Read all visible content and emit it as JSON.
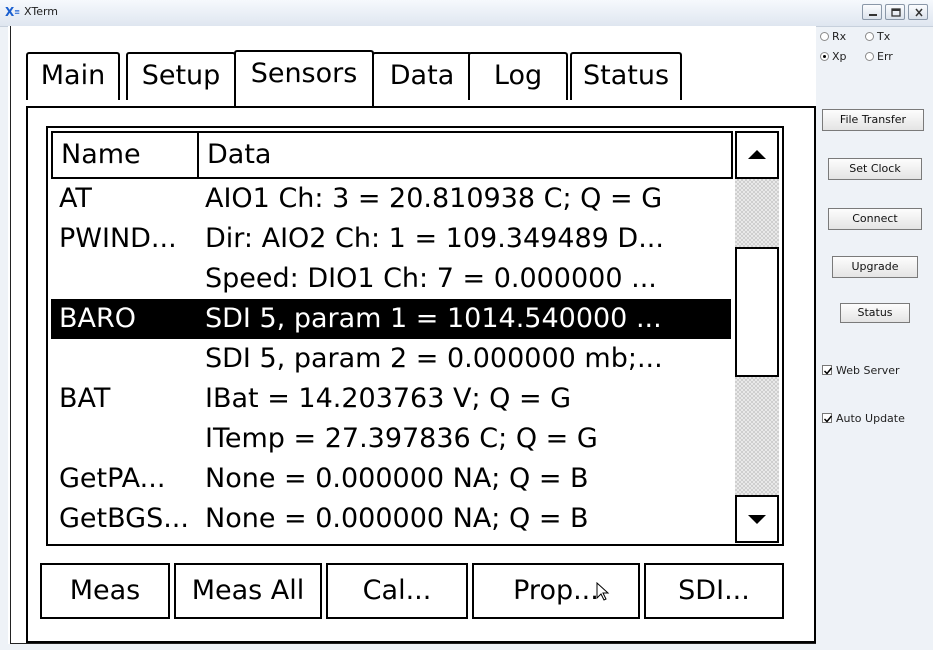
{
  "window": {
    "title": "XTerm",
    "icon": "xterm-app-icon",
    "controls": [
      "minimize-icon",
      "maximize-icon",
      "close-icon"
    ]
  },
  "tabs": [
    {
      "label": "Main",
      "active": false
    },
    {
      "label": "Setup",
      "active": false
    },
    {
      "label": "Sensors",
      "active": true
    },
    {
      "label": "Data",
      "active": false
    },
    {
      "label": "Log",
      "active": false
    },
    {
      "label": "Status",
      "active": false
    }
  ],
  "sensor_grid": {
    "columns": [
      "Name",
      "Data"
    ],
    "rows": [
      {
        "name": "AT",
        "data": "AIO1 Ch: 3 = 20.810938 C; Q = G",
        "selected": false
      },
      {
        "name": "PWIND...",
        "data": "Dir: AIO2 Ch: 1 = 109.349489 D...",
        "selected": false
      },
      {
        "name": "",
        "data": "Speed: DIO1 Ch: 7 = 0.000000 ...",
        "selected": false
      },
      {
        "name": "BARO",
        "data": "SDI 5, param 1 = 1014.540000 ...",
        "selected": true
      },
      {
        "name": "",
        "data": "SDI 5, param 2 = 0.000000 mb;...",
        "selected": false
      },
      {
        "name": "BAT",
        "data": "IBat = 14.203763 V; Q = G",
        "selected": false
      },
      {
        "name": "",
        "data": "ITemp = 27.397836 C; Q = G",
        "selected": false
      },
      {
        "name": "GetPA...",
        "data": "None = 0.000000 NA; Q = B",
        "selected": false
      },
      {
        "name": "GetBGS...",
        "data": "None = 0.000000 NA; Q = B",
        "selected": false
      }
    ],
    "scroll_up_icon": "arrow-up-icon",
    "scroll_down_icon": "arrow-down-icon"
  },
  "action_buttons": [
    "Meas",
    "Meas All",
    "Cal...",
    "Prop...",
    "SDI..."
  ],
  "side_panel": {
    "radios": [
      {
        "label": "Rx",
        "selected": false
      },
      {
        "label": "Tx",
        "selected": false
      },
      {
        "label": "Xp",
        "selected": true
      },
      {
        "label": "Err",
        "selected": false
      }
    ],
    "buttons": [
      "File Transfer",
      "Set Clock",
      "Connect",
      "Upgrade",
      "Status"
    ],
    "checkboxes": [
      {
        "label": "Web Server",
        "checked": true
      },
      {
        "label": "Auto Update",
        "checked": true
      }
    ]
  }
}
